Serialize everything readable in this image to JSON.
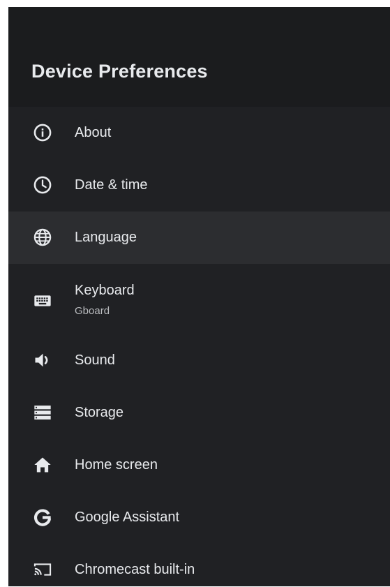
{
  "header": {
    "title": "Device Preferences"
  },
  "items": [
    {
      "label": "About"
    },
    {
      "label": "Date & time"
    },
    {
      "label": "Language"
    },
    {
      "label": "Keyboard",
      "sublabel": "Gboard"
    },
    {
      "label": "Sound"
    },
    {
      "label": "Storage"
    },
    {
      "label": "Home screen"
    },
    {
      "label": "Google Assistant"
    },
    {
      "label": "Chromecast built-in"
    }
  ],
  "icons": [
    "info-icon",
    "clock-icon",
    "globe-icon",
    "keyboard-icon",
    "speaker-icon",
    "storage-icon",
    "home-icon",
    "google-g-icon",
    "cast-icon"
  ],
  "colors": {
    "background": "#202124",
    "header": "#1b1c1e",
    "focused": "#2c2d30",
    "text": "#e8eaed"
  }
}
